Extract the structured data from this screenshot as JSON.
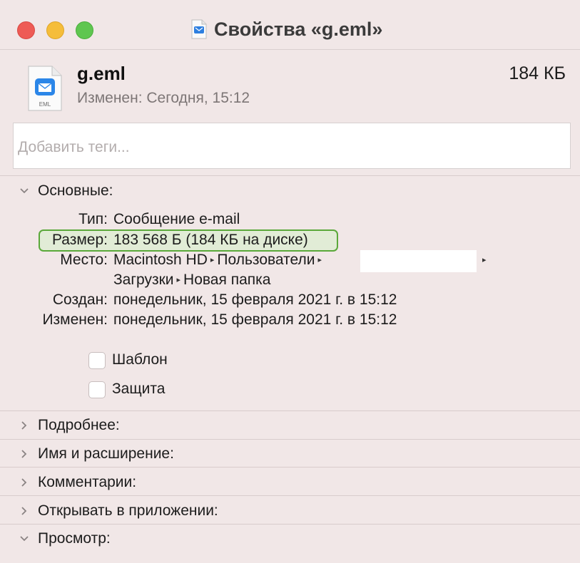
{
  "window": {
    "title": "Свойства «g.eml»"
  },
  "file": {
    "name": "g.eml",
    "icon_label": "EML",
    "modified_label": "Изменен:",
    "modified_value": "Сегодня, 15:12",
    "size": "184 КБ"
  },
  "tags": {
    "placeholder": "Добавить теги..."
  },
  "general": {
    "header": "Основные:",
    "expanded": true,
    "rows": [
      {
        "label": "Тип:",
        "value": "Сообщение e-mail"
      },
      {
        "label": "Размер:",
        "value": "183 568 Б (184 КБ на диске)"
      },
      {
        "label": "Место:",
        "value_parts": [
          "Macintosh HD",
          "Пользователи"
        ],
        "value_line2_parts": [
          "Загрузки",
          "Новая папка"
        ]
      },
      {
        "label": "Создан:",
        "value": "понедельник, 15 февраля 2021 г. в 15:12"
      },
      {
        "label": "Изменен:",
        "value": "понедельник, 15 февраля 2021 г. в 15:12"
      }
    ],
    "checkboxes": [
      {
        "label": "Шаблон",
        "checked": false
      },
      {
        "label": "Защита",
        "checked": false
      }
    ]
  },
  "sections": [
    {
      "label": "Подробнее:",
      "expanded": false
    },
    {
      "label": "Имя и расширение:",
      "expanded": false
    },
    {
      "label": "Комментарии:",
      "expanded": false
    },
    {
      "label": "Открывать в приложении:",
      "expanded": false
    },
    {
      "label": "Просмотр:",
      "expanded": true
    }
  ],
  "colors": {
    "background": "#f1e7e7",
    "highlight_border": "#5aa83a",
    "highlight_fill": "#e1ecd6",
    "close": "#ee5b55",
    "minimize": "#f5bd3a",
    "zoom": "#5fc650"
  }
}
